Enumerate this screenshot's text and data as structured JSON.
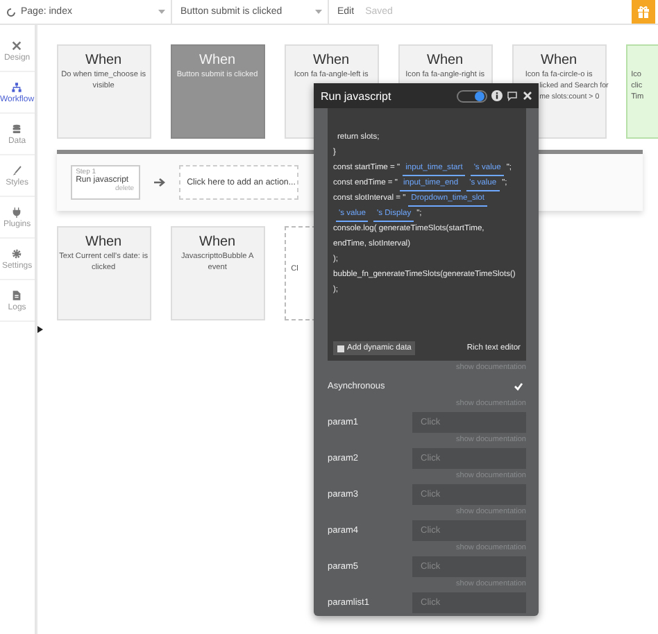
{
  "topbar": {
    "page": "Page: index",
    "event": "Button submit is clicked",
    "mode": "Edit",
    "status": "Saved"
  },
  "sidebar": {
    "items": [
      {
        "label": "Design",
        "selected": false
      },
      {
        "label": "Workflow",
        "selected": true
      },
      {
        "label": "Data",
        "selected": false
      },
      {
        "label": "Styles",
        "selected": false
      },
      {
        "label": "Plugins",
        "selected": false
      },
      {
        "label": "Settings",
        "selected": false
      },
      {
        "label": "Logs",
        "selected": false
      }
    ]
  },
  "events_top": [
    {
      "kind": "event",
      "title": "When",
      "lines": [
        "Do when time_choose is visible"
      ],
      "selected": false
    },
    {
      "kind": "event",
      "title": "When",
      "lines": [
        "Button submit is clicked"
      ],
      "selected": true
    },
    {
      "kind": "event",
      "title": "When",
      "lines": [
        "Icon fa fa-angle-left is"
      ],
      "selected": false
    },
    {
      "kind": "event",
      "title": "When",
      "lines": [
        "Icon fa fa-angle-right is"
      ],
      "selected": false
    },
    {
      "kind": "partial",
      "title": "When",
      "lines": [
        "Icon fa fa-circle-o is",
        "licked and Search for",
        "me slots:count > 0"
      ],
      "selected": false
    },
    {
      "kind": "cut",
      "lines": [
        "Ico",
        "clic",
        "Tim"
      ],
      "selected": false
    }
  ],
  "actions": {
    "steps": [
      {
        "step": "Step 1",
        "name": "Run javascript",
        "delete": "delete"
      }
    ],
    "add": "Click here to add an action..."
  },
  "events_bottom": [
    {
      "kind": "event",
      "title": "When",
      "lines": [
        "Text Current cell's date: is clicked"
      ],
      "selected": false
    },
    {
      "kind": "event",
      "title": "When",
      "lines": [
        "JavascripttoBubble A event"
      ],
      "selected": false
    },
    {
      "kind": "add",
      "lines": [
        "Cl"
      ],
      "selected": false
    }
  ],
  "panel": {
    "title": "Run javascript",
    "toggle_on": true,
    "code": [
      [
        {
          "kind": "text",
          "text": "return slots;"
        }
      ],
      [
        {
          "kind": "text",
          "text": "}"
        }
      ],
      [
        {
          "kind": "text",
          "text": "const startTime = \""
        },
        {
          "kind": "dynamic",
          "text": "input_time_start"
        },
        {
          "kind": "dynamic",
          "text": "'s value"
        },
        {
          "kind": "text",
          "text": "\";"
        }
      ],
      [
        {
          "kind": "text",
          "text": "const endTime = \""
        },
        {
          "kind": "dynamic",
          "text": "input_time_end"
        },
        {
          "kind": "dynamic",
          "text": "'s value"
        },
        {
          "kind": "text",
          "text": "\";"
        }
      ],
      [
        {
          "kind": "text",
          "text": "const slotInterval = \""
        },
        {
          "kind": "dynamic",
          "text": "Dropdown_time_slot"
        },
        {
          "kind": "dynamic",
          "text": "'s value"
        },
        {
          "kind": "dynamic",
          "text": "'s Display"
        },
        {
          "kind": "text",
          "text": "\";"
        }
      ],
      [
        {
          "kind": "text",
          "text": "console.log( generateTimeSlots(startTime,"
        }
      ],
      [
        {
          "kind": "text",
          "text": "endTime, slotInterval)"
        }
      ],
      [
        {
          "kind": "text",
          "text": ");"
        }
      ],
      [
        {
          "kind": "text",
          "text": "bubble_fn_generateTimeSlots(generateTimeSlots()"
        }
      ],
      [
        {
          "kind": "text",
          "text": ");"
        }
      ]
    ],
    "add_dynamic": "Add dynamic data",
    "rich_text": "Rich text editor",
    "doc": "show documentation",
    "rows": [
      {
        "kind": "checkbox",
        "label": "Asynchronous",
        "checked": true,
        "doc": "show documentation"
      },
      {
        "kind": "field",
        "label": "param1",
        "placeholder": "Click",
        "doc": "show documentation"
      },
      {
        "kind": "field",
        "label": "param2",
        "placeholder": "Click",
        "doc": "show documentation"
      },
      {
        "kind": "field",
        "label": "param3",
        "placeholder": "Click",
        "doc": "show documentation"
      },
      {
        "kind": "field",
        "label": "param4",
        "placeholder": "Click",
        "doc": "show documentation"
      },
      {
        "kind": "field",
        "label": "param5",
        "placeholder": "Click",
        "doc": "show documentation"
      },
      {
        "kind": "field",
        "label": "paramlist1",
        "placeholder": "Click"
      }
    ]
  }
}
